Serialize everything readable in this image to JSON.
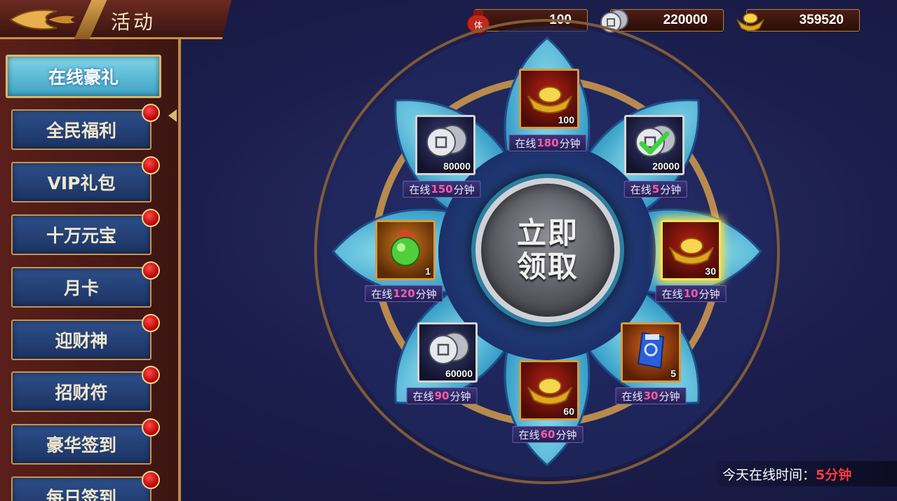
{
  "header": {
    "title": "活动"
  },
  "currency": [
    {
      "icon": "stamina-pot-icon",
      "value": "100"
    },
    {
      "icon": "silver-coin-icon",
      "value": "220000"
    },
    {
      "icon": "gold-ingot-icon",
      "value": "359520"
    }
  ],
  "sidebar": {
    "items": [
      {
        "label": "在线豪礼",
        "active": true,
        "dot": false
      },
      {
        "label": "全民福利",
        "active": false,
        "dot": true
      },
      {
        "label": "VIP礼包",
        "active": false,
        "dot": true
      },
      {
        "label": "十万元宝",
        "active": false,
        "dot": true
      },
      {
        "label": "月卡",
        "active": false,
        "dot": true
      },
      {
        "label": "迎财神",
        "active": false,
        "dot": true
      },
      {
        "label": "招财符",
        "active": false,
        "dot": true
      },
      {
        "label": "豪华签到",
        "active": false,
        "dot": true
      },
      {
        "label": "每日签到",
        "active": false,
        "dot": true
      }
    ]
  },
  "wheel": {
    "claim_line1": "立即",
    "claim_line2": "领取",
    "rewards": [
      {
        "item": "gold-ingot-icon",
        "count": "100",
        "label_prefix": "在线",
        "minutes": "180",
        "label_suffix": "分钟"
      },
      {
        "item": "silver-coin-icon",
        "count": "20000",
        "label_prefix": "在线",
        "minutes": "5",
        "label_suffix": "分钟",
        "claimed": true
      },
      {
        "item": "gold-ingot-icon",
        "count": "30",
        "label_prefix": "在线",
        "minutes": "10",
        "label_suffix": "分钟",
        "highlight": true
      },
      {
        "item": "blue-talisman-icon",
        "count": "5",
        "label_prefix": "在线",
        "minutes": "30",
        "label_suffix": "分钟"
      },
      {
        "item": "gold-ingot-icon",
        "count": "60",
        "label_prefix": "在线",
        "minutes": "60",
        "label_suffix": "分钟"
      },
      {
        "item": "silver-coin-icon",
        "count": "60000",
        "label_prefix": "在线",
        "minutes": "90",
        "label_suffix": "分钟"
      },
      {
        "item": "green-orb-icon",
        "count": "1",
        "label_prefix": "在线",
        "minutes": "120",
        "label_suffix": "分钟"
      },
      {
        "item": "silver-coin-icon",
        "count": "80000",
        "label_prefix": "在线",
        "minutes": "150",
        "label_suffix": "分钟"
      }
    ]
  },
  "online_time": {
    "label": "今天在线时间：",
    "value": "5分钟"
  },
  "colors": {
    "accent_gold": "#c9923e",
    "minutes_pink": "#ff5aa8",
    "time_red": "#ff3b3b"
  }
}
